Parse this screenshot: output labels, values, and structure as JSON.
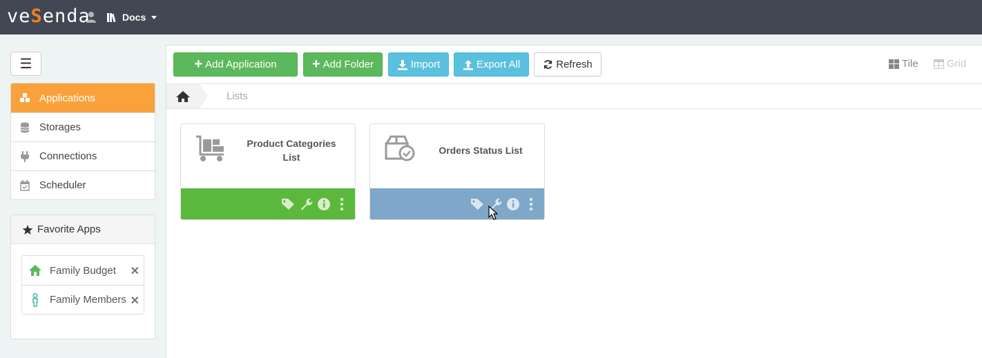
{
  "header": {
    "logo_pre": "ve",
    "logo_accent": "S",
    "logo_post": "enda",
    "docs_label": "Docs",
    "user_icon": "user-icon",
    "docs_icon": "books-icon"
  },
  "sidebar": {
    "menu_icon": "☰",
    "items": [
      {
        "label": "Applications",
        "icon": "cubes-icon",
        "active": true
      },
      {
        "label": "Storages",
        "icon": "database-icon"
      },
      {
        "label": "Connections",
        "icon": "plug-icon"
      },
      {
        "label": "Scheduler",
        "icon": "calendar-check-icon"
      }
    ],
    "favorites": {
      "title": "Favorite Apps",
      "items": [
        {
          "label": "Family Budget",
          "icon": "home-icon",
          "color": "#5cb85c"
        },
        {
          "label": "Family Members",
          "icon": "person-icon",
          "color": "#3bb0a0"
        }
      ],
      "remove_symbol": "✕"
    }
  },
  "toolbar": {
    "add_application": "Add Application",
    "add_folder": "Add Folder",
    "import": "Import",
    "export_all": "Export All",
    "refresh": "Refresh",
    "tile": "Tile",
    "grid": "Grid"
  },
  "breadcrumb": {
    "current": "Lists"
  },
  "cards": [
    {
      "title_line1": "Product Categories",
      "title_line2": "List",
      "icon": "dolly-boxes-icon",
      "footer_color": "#5cb83c"
    },
    {
      "title_line1": "Orders Status List",
      "title_line2": "",
      "icon": "box-check-icon",
      "footer_color": "#7fa7c9"
    }
  ],
  "colors": {
    "topbar": "#414753",
    "accent_orange": "#f9a23b",
    "success": "#5cb85c",
    "info": "#5bc0de"
  }
}
